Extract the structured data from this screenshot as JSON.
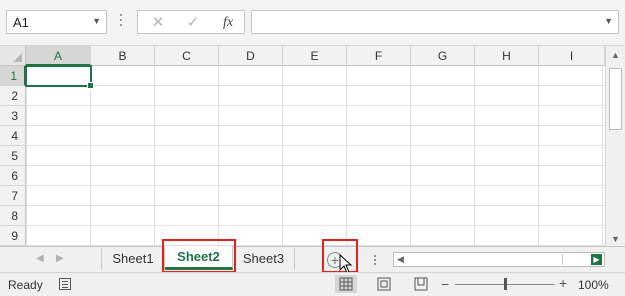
{
  "formula_bar": {
    "name_box": "A1",
    "cancel_glyph": "✕",
    "enter_glyph": "✓",
    "fx_label": "fx",
    "formula_value": ""
  },
  "grid": {
    "columns": [
      "A",
      "B",
      "C",
      "D",
      "E",
      "F",
      "G",
      "H",
      "I"
    ],
    "rows": [
      "1",
      "2",
      "3",
      "4",
      "5",
      "6",
      "7",
      "8",
      "9"
    ],
    "selected_cell": "A1"
  },
  "sheets": {
    "tabs": [
      {
        "label": "Sheet1",
        "active": false
      },
      {
        "label": "Sheet2",
        "active": true
      },
      {
        "label": "Sheet3",
        "active": false
      }
    ],
    "add_sheet_glyph": "+"
  },
  "status_bar": {
    "status": "Ready",
    "zoom": "100%"
  },
  "colors": {
    "accent": "#217346",
    "highlight": "#e2231a"
  },
  "icons": {
    "name_box_dropdown": "chevron-down-icon",
    "cancel": "close-icon",
    "enter": "check-icon",
    "function": "fx-icon",
    "add_sheet": "plus-circle-icon",
    "cursor": "mouse-pointer-icon",
    "macro": "macro-record-icon",
    "normal_view": "normal-view-icon",
    "page_layout_view": "page-layout-icon",
    "page_break_view": "page-break-icon"
  }
}
